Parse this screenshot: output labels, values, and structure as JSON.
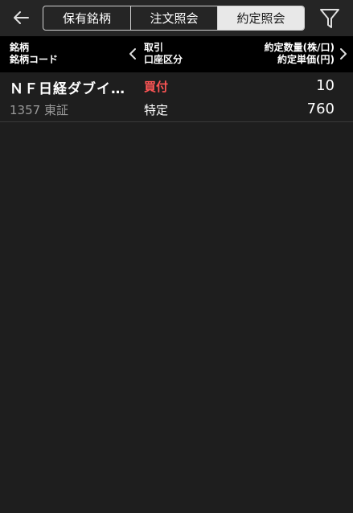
{
  "topbar": {
    "tabs": [
      {
        "label": "保有銘柄",
        "active": false
      },
      {
        "label": "注文照会",
        "active": false
      },
      {
        "label": "約定照会",
        "active": true
      }
    ],
    "back_icon": "arrow-left-icon",
    "filter_icon": "filter-icon"
  },
  "header": {
    "col1_line1": "銘柄",
    "col1_line2": "銘柄コード",
    "col2_line1": "取引",
    "col2_line2": "口座区分",
    "col3_line1": "約定数量(株/口)",
    "col3_line2": "約定単価(円)"
  },
  "rows": [
    {
      "name": "ＮＦ日経ダブイ…",
      "code_market": "1357  東証",
      "trade_type": "買付",
      "account_type": "特定",
      "quantity": "10",
      "price": "760"
    }
  ],
  "colors": {
    "background": "#1e1e1e",
    "header": "#000000",
    "buy": "#ff5555",
    "secondary_text": "#9a9a9a"
  }
}
